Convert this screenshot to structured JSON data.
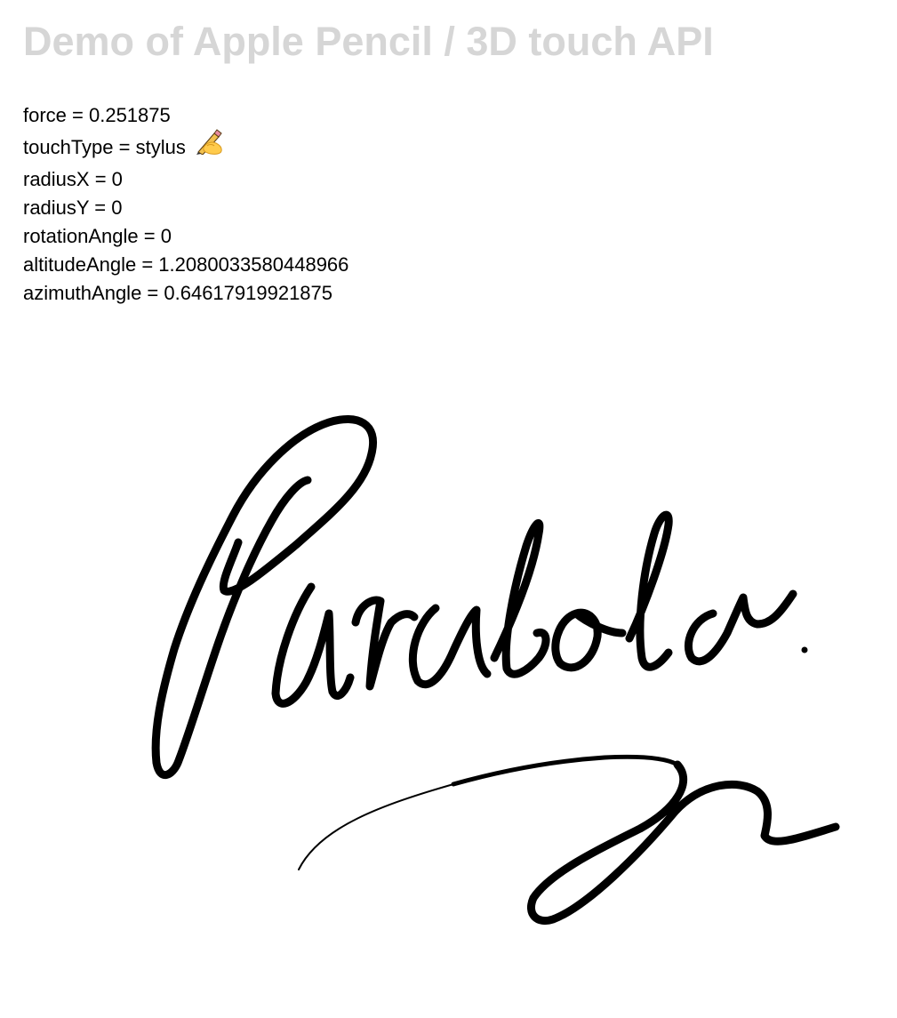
{
  "header": {
    "title": "Demo of Apple Pencil / 3D touch API"
  },
  "readouts": {
    "force": "force = 0.251875",
    "touch_type": "touchType = stylus",
    "touch_type_emoji": "writing-hand-icon",
    "radius_x": "radiusX = 0",
    "radius_y": "radiusY = 0",
    "rotation_angle": "rotationAngle = 0",
    "altitude_angle": "altitudeAngle = 1.2080033580448966",
    "azimuth_angle": "azimuthAngle = 0.64617919921875"
  },
  "canvas": {
    "handwriting_text": "Parabola",
    "ink_color": "#000000",
    "background_color": "#ffffff"
  },
  "colors": {
    "title": "#d6d6d6",
    "text": "#000000"
  }
}
